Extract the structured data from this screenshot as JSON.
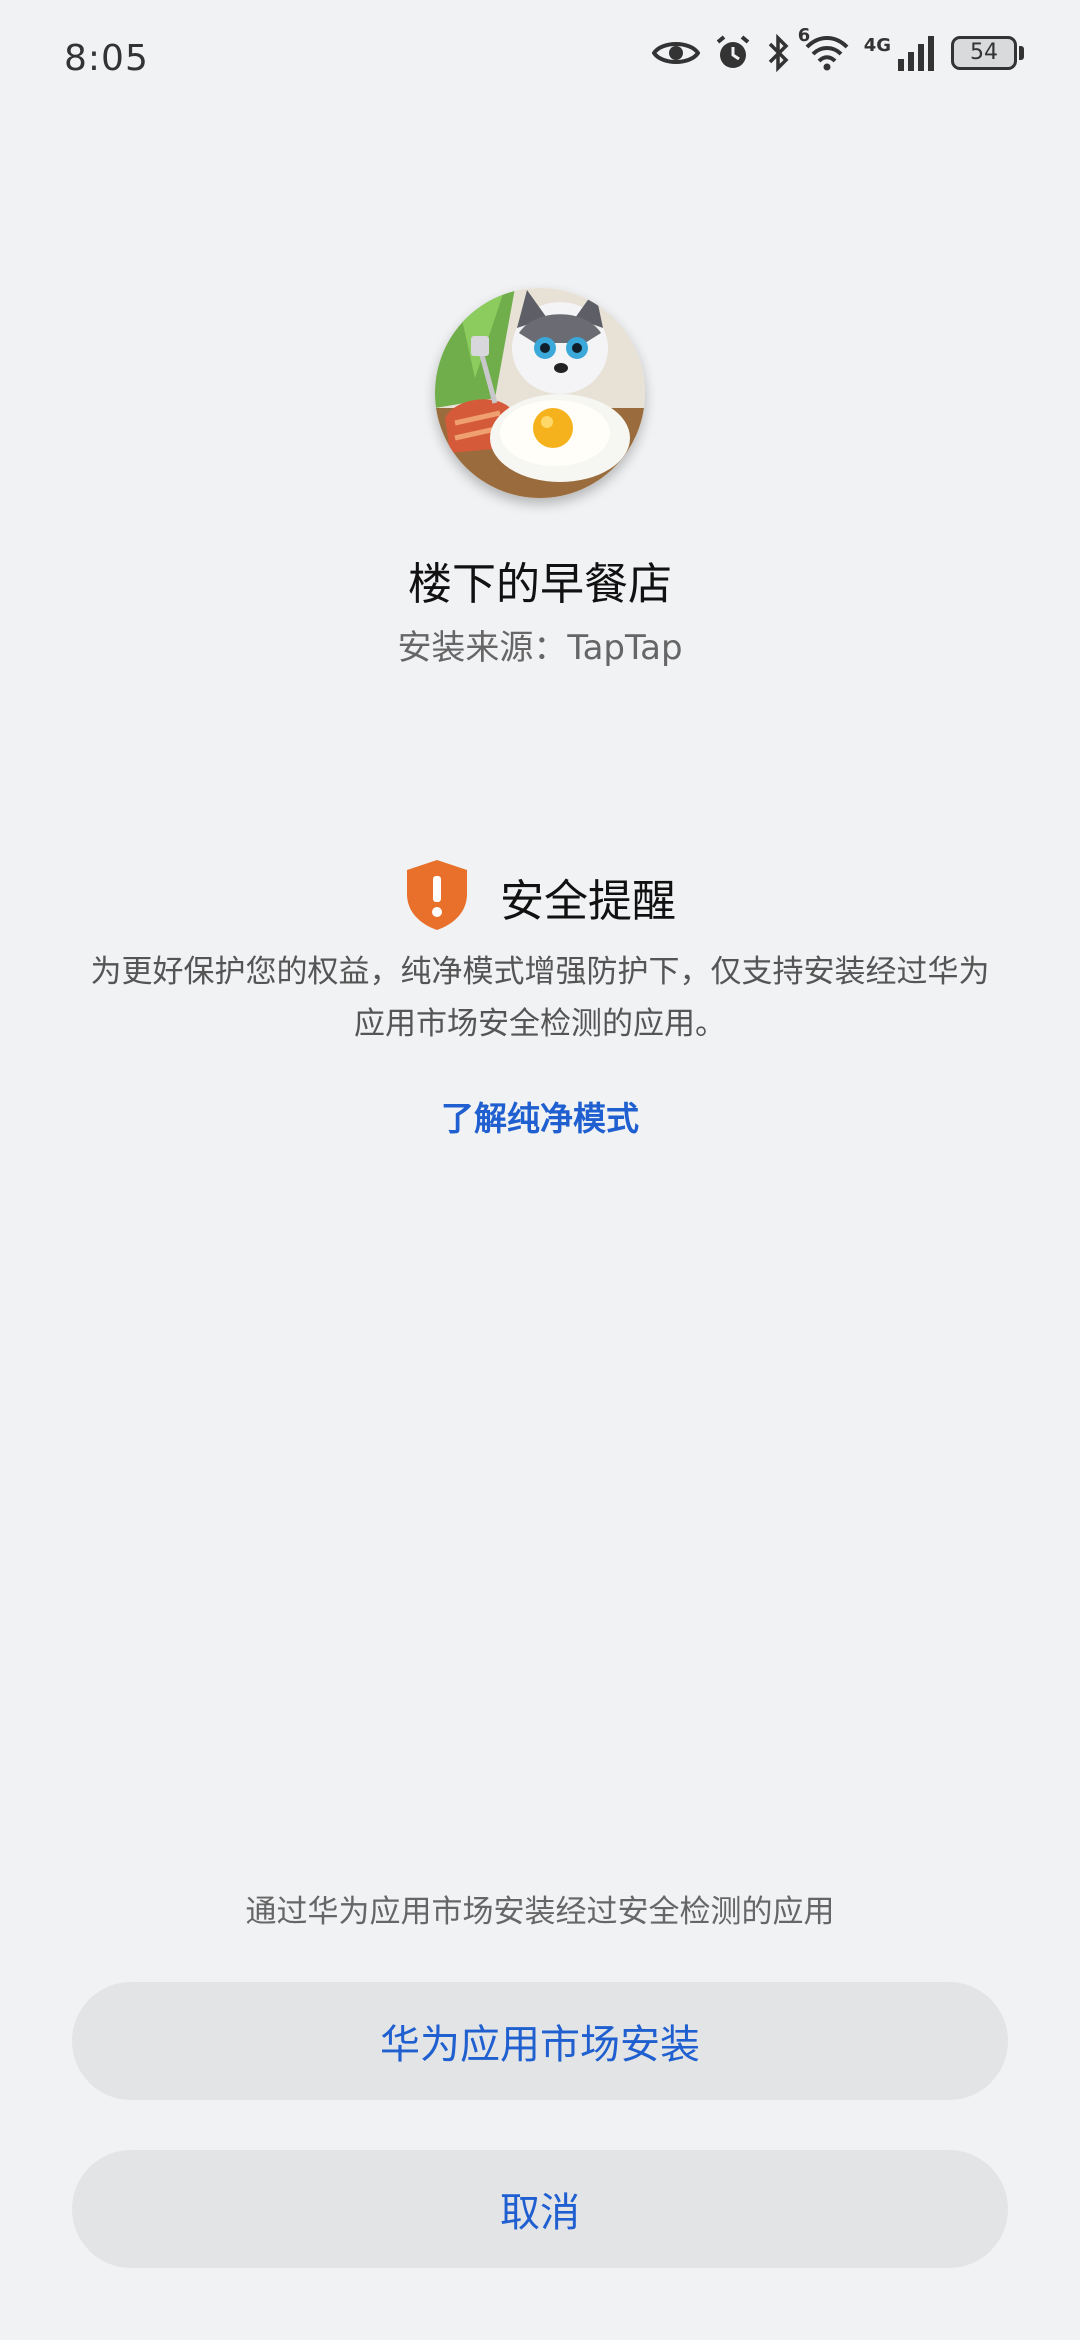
{
  "status_bar": {
    "time": "8:05",
    "network": "4G",
    "wifi_badge": "6",
    "battery": "54",
    "icons": [
      "eye-icon",
      "alarm-icon",
      "bluetooth-icon",
      "wifi-icon",
      "signal-icon",
      "battery-icon"
    ]
  },
  "app": {
    "name": "楼下的早餐店",
    "source": "安装来源：TapTap",
    "icon": "app-icon"
  },
  "notice": {
    "title": "安全提醒",
    "body": "为更好保护您的权益，纯净模式增强防护下，仅支持安装经过华为应用市场安全检测的应用。",
    "link": "了解纯净模式",
    "icon": "shield-warning-icon",
    "icon_color": "#e8702a"
  },
  "footer": {
    "hint": "通过华为应用市场安装经过安全检测的应用",
    "install_button": "华为应用市场安装",
    "cancel_button": "取消"
  },
  "colors": {
    "background": "#f1f2f4",
    "accent": "#1f5fd0",
    "button_bg": "#e3e4e6"
  }
}
